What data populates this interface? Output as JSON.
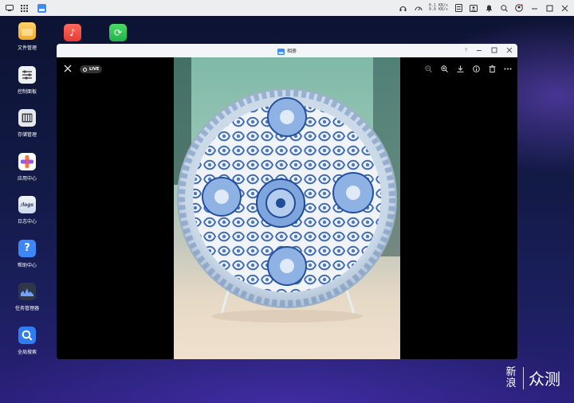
{
  "desktop": {
    "icons": [
      {
        "label": "文件管理",
        "color": "#f3b42b",
        "glyph": ""
      },
      {
        "label": "控制面板",
        "color": "#eef0f3",
        "glyph": "≡"
      },
      {
        "label": "存储管理",
        "color": "#e9ebef",
        "glyph": "▥"
      },
      {
        "label": "应用中心",
        "color": "#ffffff",
        "glyph": "✚"
      },
      {
        "label": "日志中心",
        "color": "#dde6f6",
        "glyph": "/logs"
      },
      {
        "label": "帮助中心",
        "color": "#3d86f5",
        "glyph": "?"
      },
      {
        "label": "任务管理器",
        "color": "#2f3647",
        "glyph": "▲"
      },
      {
        "label": "全局搜索",
        "color": "#2f7df0",
        "glyph": "○"
      }
    ]
  },
  "topbar": {
    "net_up": "0.1 KB/s",
    "net_down": "0.0 KB/s"
  },
  "window": {
    "title": "相册",
    "help": "?"
  },
  "viewer": {
    "badge": "LIVE"
  },
  "watermark": {
    "line1": "新",
    "line2": "浪",
    "text": "众测"
  }
}
